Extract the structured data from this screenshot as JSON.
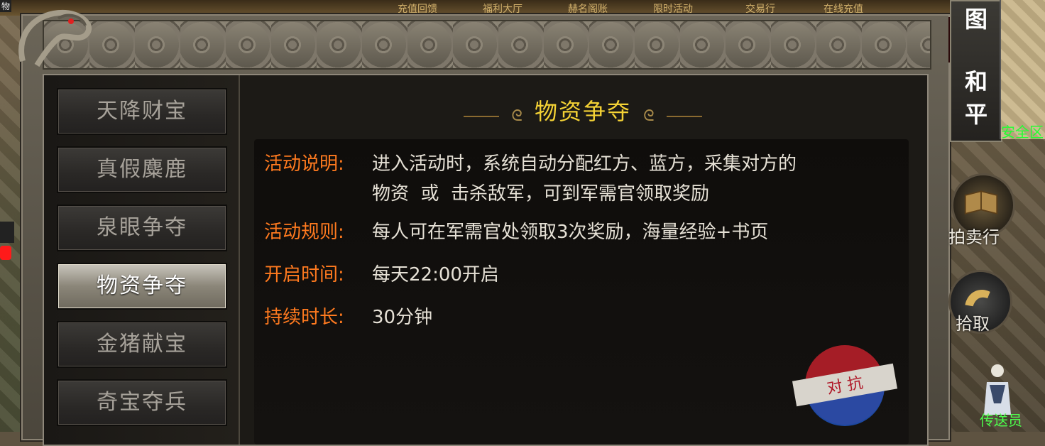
{
  "top_bar": {
    "corner_label": "物",
    "items": [
      "充值回馈",
      "福利大厅",
      "赫名阁账",
      "限时活动",
      "交易行",
      "在线充值"
    ]
  },
  "window": {
    "tabs": [
      {
        "label": "天降财宝"
      },
      {
        "label": "真假麋鹿"
      },
      {
        "label": "泉眼争夺"
      },
      {
        "label": "物资争夺"
      },
      {
        "label": "金猪献宝"
      },
      {
        "label": "奇宝夺兵"
      }
    ],
    "active_tab": "物资争夺",
    "title": "物资争夺",
    "title_deco_left": "ᘓ",
    "title_deco_right": "ᘓ",
    "close_label": "✕",
    "details": {
      "description_label": "活动说明:",
      "description_line1": "进入活动时，系统自动分配红方、蓝方，采集对方的",
      "description_line2": "物资  或  击杀敌军，可到军需官领取奖励",
      "rules_label": "活动规则:",
      "rules_value": "每人可在军需官处领取3次奖励，海量经验+书页",
      "open_time_label": "开启时间:",
      "open_time_value": "每天22:00开启",
      "duration_label": "持续时长:",
      "duration_value": "30分钟"
    },
    "stamp_text": "对 抗"
  },
  "right_hud": {
    "mode_top": "图",
    "mode_chars": [
      "和",
      "平"
    ],
    "safe_zone": "安全区",
    "buttons": [
      {
        "label": "拍卖行"
      },
      {
        "label": "拾取"
      }
    ],
    "npc_label": "传送员"
  },
  "colors": {
    "label_orange": "#ff7a1f",
    "title_yellow": "#f4d235",
    "safe_green": "#22ff33"
  }
}
